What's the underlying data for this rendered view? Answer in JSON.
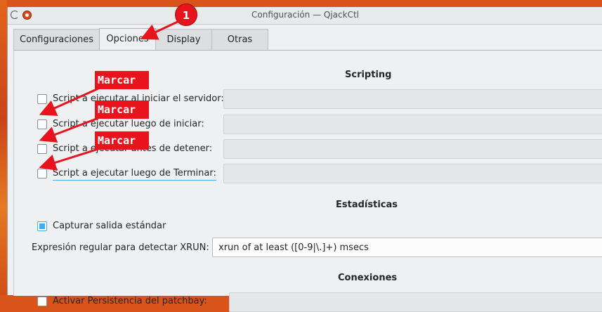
{
  "window": {
    "title": "Configuración — QjackCtl"
  },
  "tabs": [
    {
      "label": "Configuraciones",
      "active": false
    },
    {
      "label": "Opciones",
      "active": true
    },
    {
      "label": "Display",
      "active": false
    },
    {
      "label": "Otras",
      "active": false
    }
  ],
  "scripting": {
    "title": "Scripting",
    "rows": [
      {
        "label": "Script a ejecutar al iniciar el servidor:",
        "checked": false,
        "value": ""
      },
      {
        "label": "Script a ejecutar luego de iniciar:",
        "checked": false,
        "value": ""
      },
      {
        "label": "Script a ejecutar antes de detener:",
        "checked": false,
        "value": ""
      },
      {
        "label": "Script a ejecutar luego de Terminar:",
        "checked": false,
        "value": ""
      }
    ]
  },
  "estadisticas": {
    "title": "Estadísticas",
    "capture_label": "Capturar salida estándar",
    "capture_checked": true,
    "xrun_label": "Expresión regular para detectar XRUN:",
    "xrun_value": "xrun of at least ([0-9|\\.]+) msecs"
  },
  "conexiones": {
    "title": "Conexiones",
    "row_label": "Activar Persistencia del patchbay:"
  },
  "annotations": {
    "badge": "1",
    "marcar": [
      "Marcar",
      "Marcar",
      "Marcar"
    ],
    "color": "#e8131c"
  },
  "colors": {
    "accent": "#3daee9",
    "annotation": "#e8131c"
  }
}
